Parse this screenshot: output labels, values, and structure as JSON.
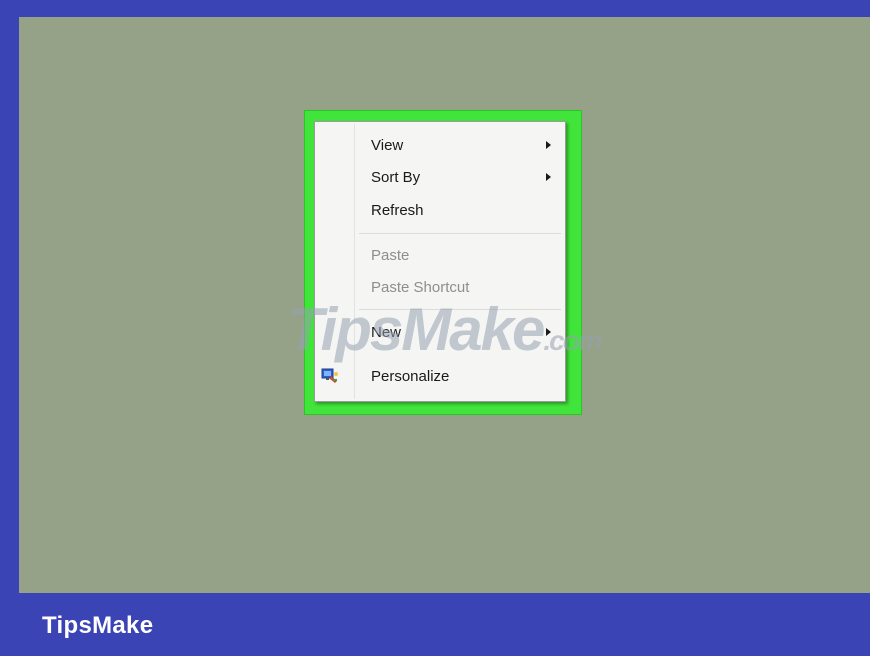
{
  "context_menu": {
    "items": [
      {
        "label": "View",
        "submenu": true,
        "enabled": true
      },
      {
        "label": "Sort By",
        "submenu": true,
        "enabled": true
      },
      {
        "label": "Refresh",
        "submenu": false,
        "enabled": true
      },
      {
        "label": "Paste",
        "submenu": false,
        "enabled": false
      },
      {
        "label": "Paste Shortcut",
        "submenu": false,
        "enabled": false
      },
      {
        "label": "New",
        "submenu": true,
        "enabled": true
      },
      {
        "label": "Personalize",
        "submenu": false,
        "enabled": true,
        "icon": "personalize-icon"
      }
    ]
  },
  "watermark": {
    "main": "TipsMake",
    "suffix": ".com"
  },
  "brand": {
    "label": "TipsMake"
  },
  "colors": {
    "frame": "#3a44b4",
    "desktop": "#96a287",
    "highlight": "#41e43b",
    "menu_bg": "#f5f5f4",
    "disabled_text": "#8e8e8e"
  }
}
